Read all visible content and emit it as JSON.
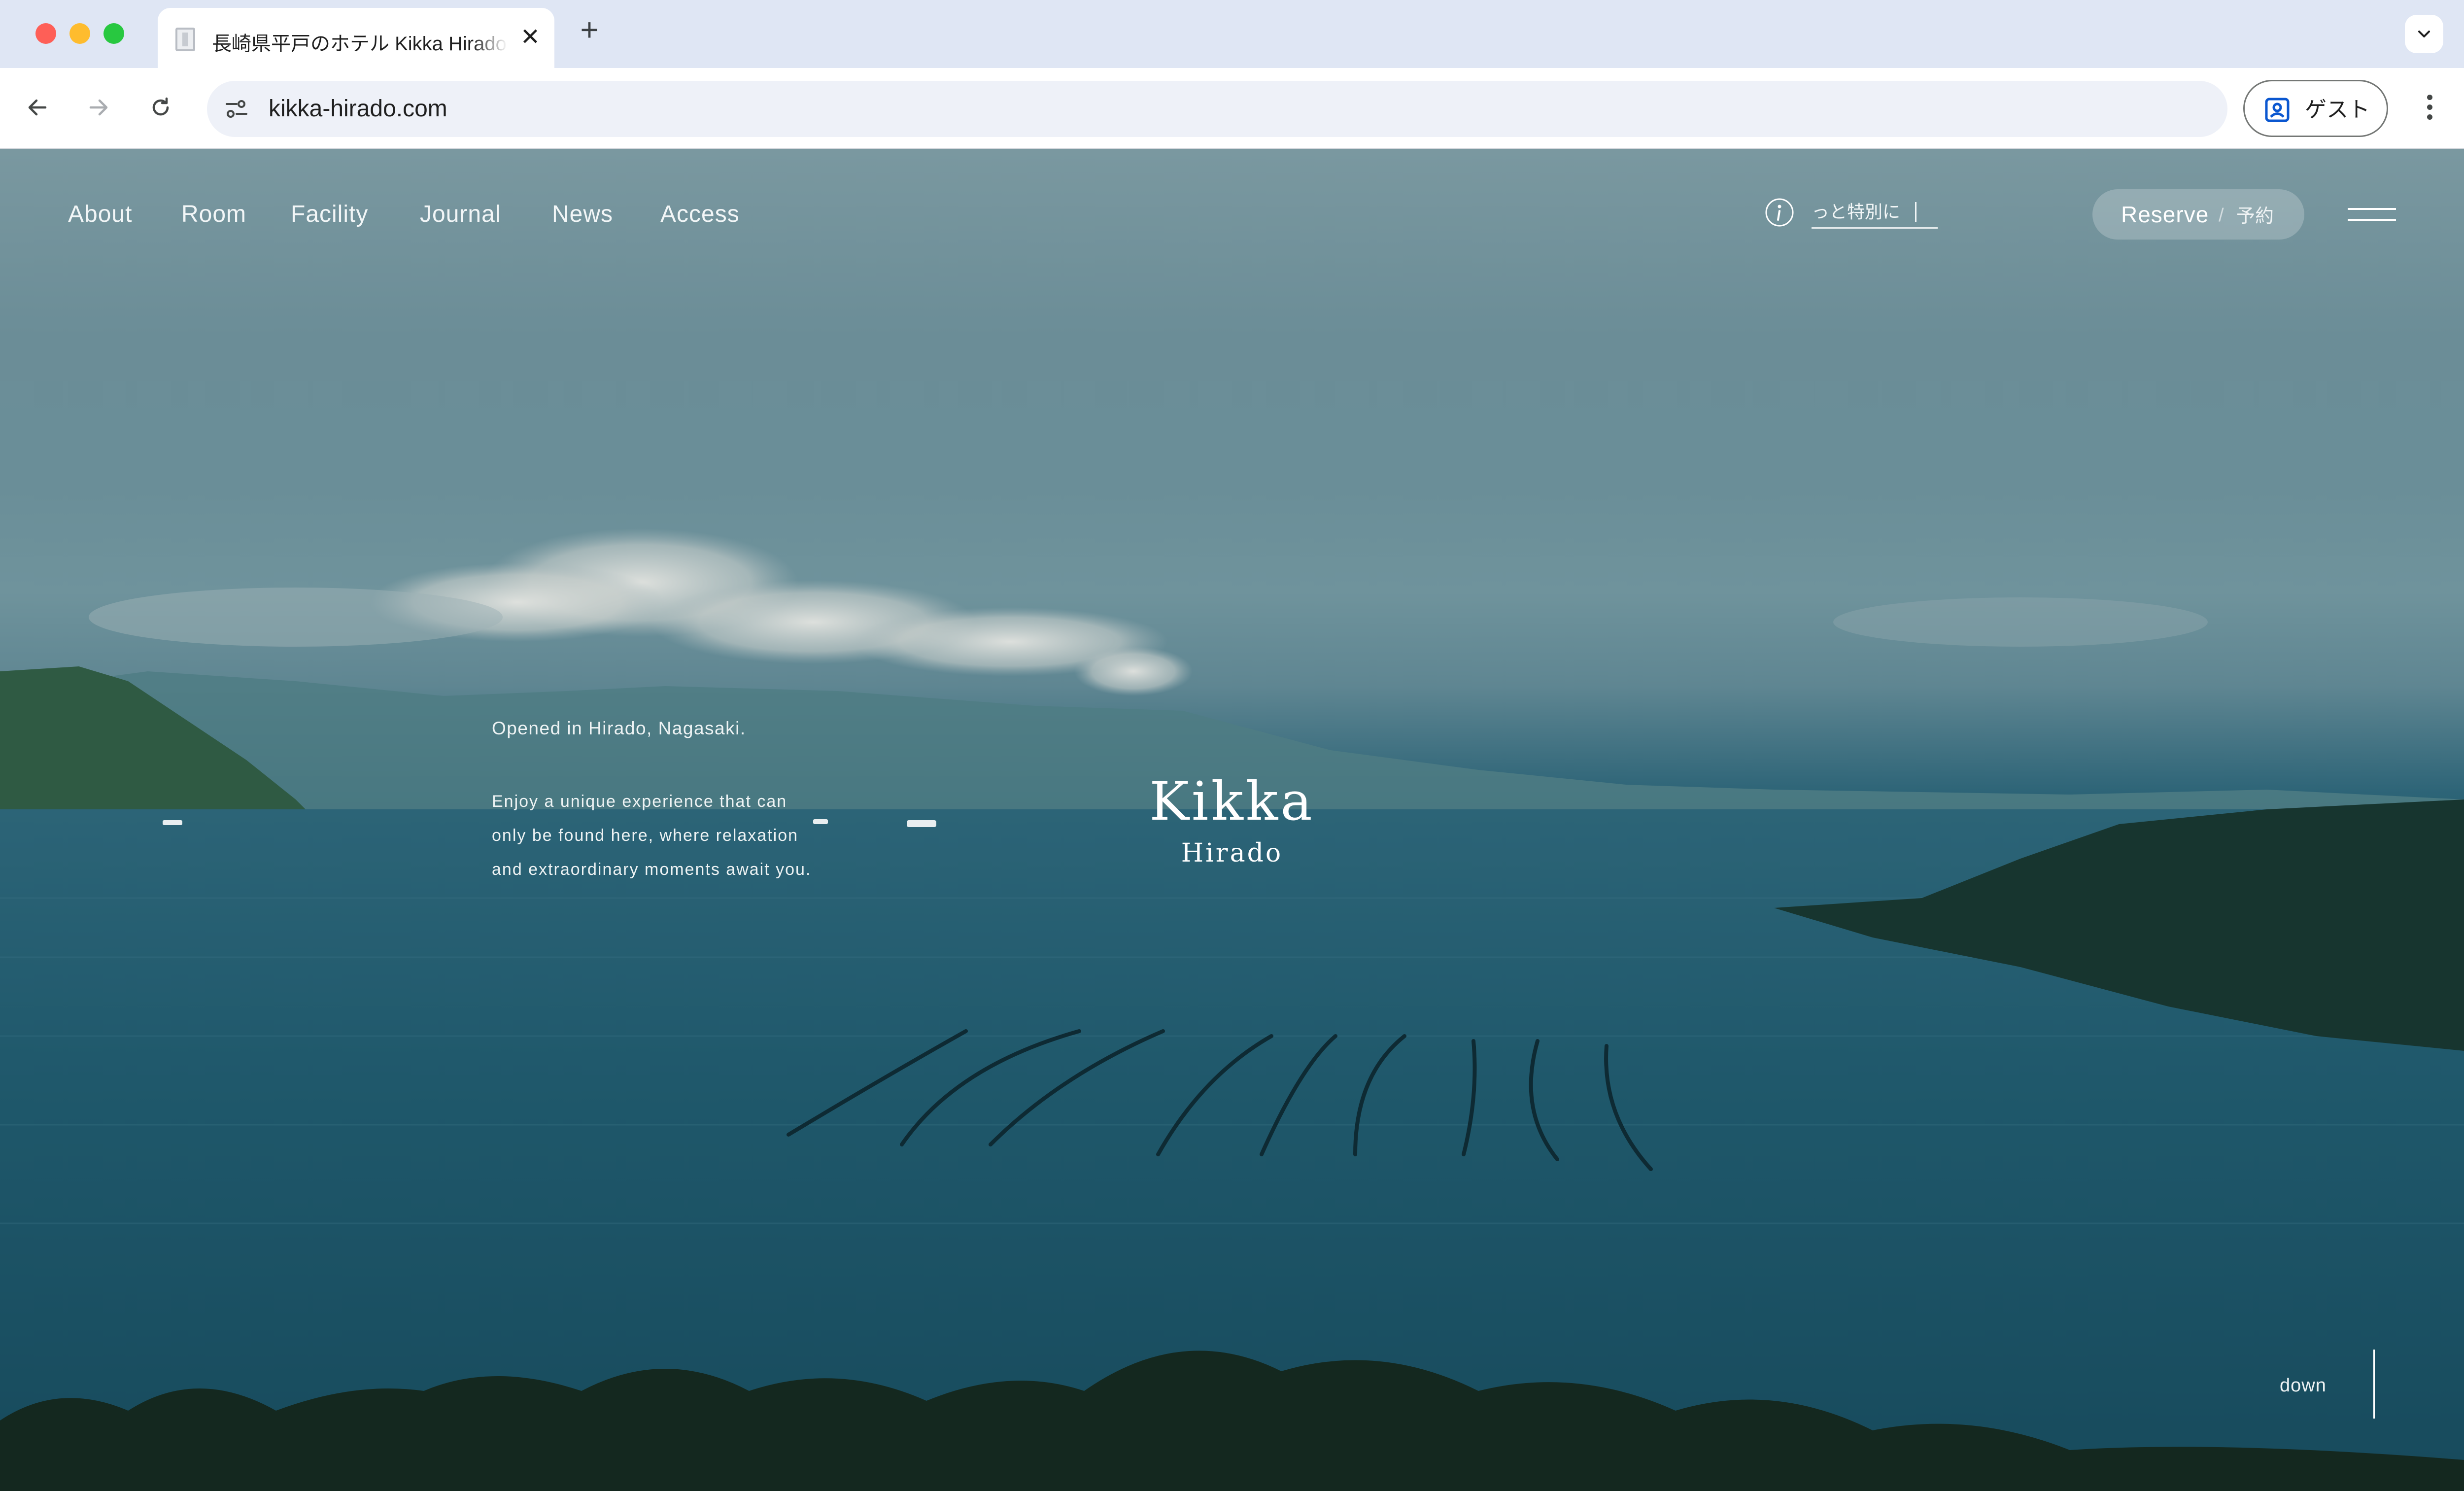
{
  "browser": {
    "tab_title": "長崎県平戸のホテル Kikka Hirado",
    "tab_close_glyph": "✕",
    "new_tab_glyph": "+",
    "url": "kikka-hirado.com",
    "profile_label": "ゲスト",
    "icons": [
      "back-arrow-icon",
      "forward-arrow-icon",
      "reload-icon",
      "site-info-icon",
      "profile-icon",
      "kebab-menu-icon",
      "chevron-down-icon"
    ]
  },
  "site": {
    "nav": [
      {
        "label": "About"
      },
      {
        "label": "Room"
      },
      {
        "label": "Facility"
      },
      {
        "label": "Journal"
      },
      {
        "label": "News"
      },
      {
        "label": "Access"
      }
    ],
    "ticker_text": "っと特別に",
    "reserve": {
      "label": "Reserve",
      "separator": "/",
      "label_jp": "予約"
    },
    "hero": {
      "tagline": "Opened in Hirado, Nagasaki.",
      "body_lines": [
        "Enjoy a unique experience that can",
        "only be found here, where relaxation",
        "and extraordinary moments await you."
      ]
    },
    "logo": {
      "name": "Kikka",
      "place": "Hirado"
    },
    "scroll_label": "down"
  },
  "colors": {
    "tabstrip": "#dfe6f4",
    "omnibox": "#eef1f8",
    "sea": "#1d5568",
    "sky": "#7a98a0"
  }
}
